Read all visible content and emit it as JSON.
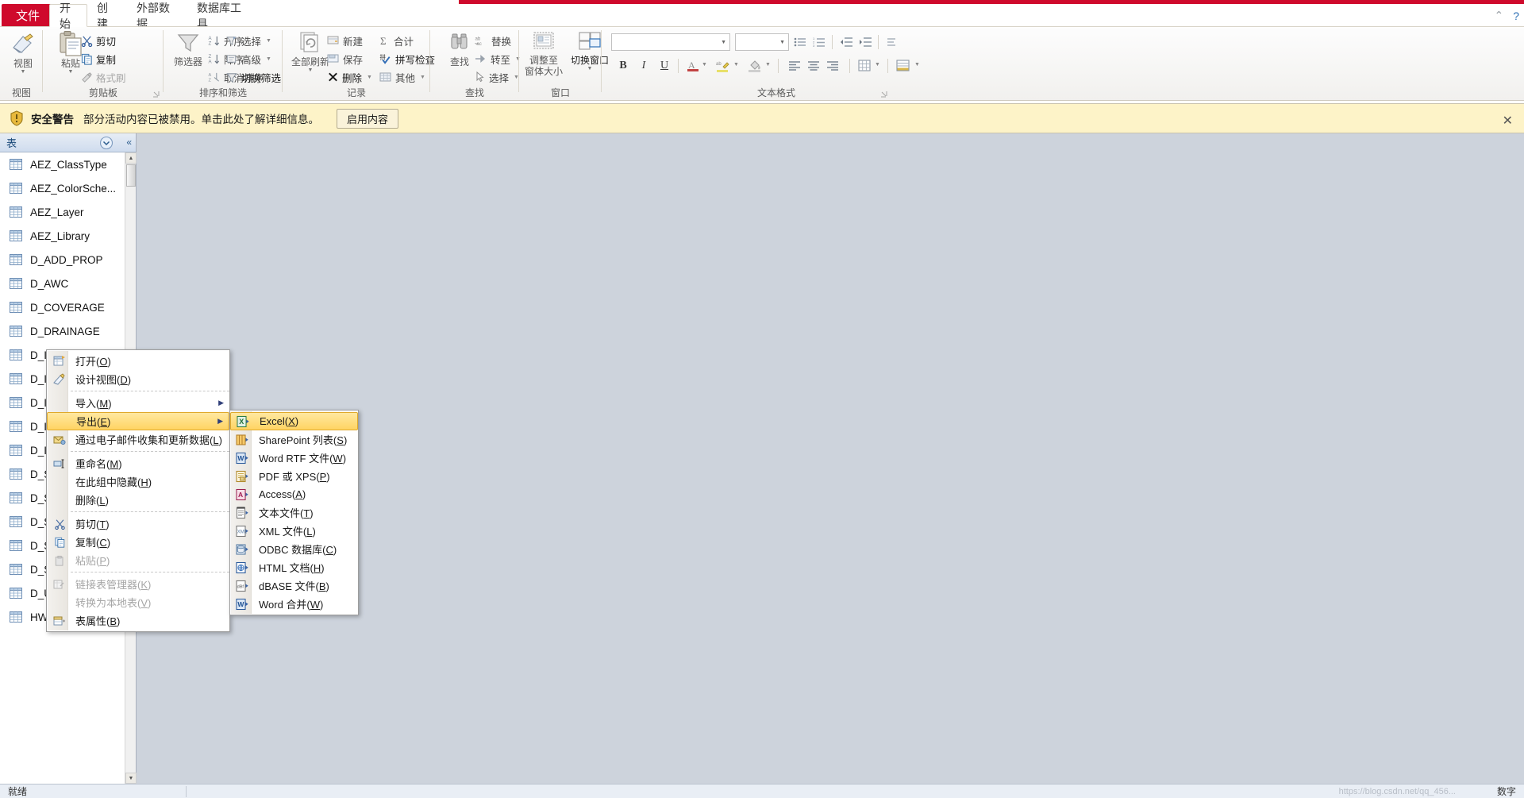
{
  "window": {
    "minimize_icon": "minimize-icon",
    "help_icon": "help-icon"
  },
  "tabs": {
    "file": "文件",
    "items": [
      {
        "label": "开始",
        "active": true
      },
      {
        "label": "创建",
        "active": false
      },
      {
        "label": "外部数据",
        "active": false
      },
      {
        "label": "数据库工具",
        "active": false
      }
    ]
  },
  "ribbon": {
    "groups": [
      {
        "name": "视图"
      },
      {
        "name": "剪贴板"
      },
      {
        "name": "排序和筛选"
      },
      {
        "name": "记录"
      },
      {
        "name": "查找"
      },
      {
        "name": "窗口"
      },
      {
        "name": "文本格式"
      }
    ],
    "view": {
      "label": "视图"
    },
    "clipboard": {
      "paste": "粘贴",
      "cut": "剪切",
      "copy": "复制",
      "format_painter": "格式刷"
    },
    "sort_filter": {
      "filter": "筛选器",
      "asc": "升序",
      "desc": "降序",
      "clear_sort": "取消排序",
      "selection": "选择",
      "advanced": "高级",
      "toggle_filter": "切换筛选"
    },
    "records": {
      "refresh_all": "全部刷新",
      "new": "新建",
      "save": "保存",
      "delete": "删除",
      "totals": "合计",
      "spelling": "拼写检查",
      "more": "其他"
    },
    "find": {
      "find": "查找",
      "replace": "替换",
      "goto": "转至",
      "select": "选择"
    },
    "window": {
      "size_to_form": "调整至\n窗体大小",
      "size_to_form_line1": "调整至",
      "size_to_form_line2": "窗体大小",
      "switch_windows": "切换窗口"
    },
    "text_format": {
      "font_name": "",
      "font_size": "",
      "bold": "B",
      "italic": "I",
      "underline": "U"
    }
  },
  "security_bar": {
    "title": "安全警告",
    "message": "部分活动内容已被禁用。单击此处了解详细信息。",
    "button": "启用内容",
    "close": "✕"
  },
  "nav_pane": {
    "header": "表",
    "collapse": "«",
    "tables": [
      "AEZ_ClassType",
      "AEZ_ColorSche...",
      "AEZ_Layer",
      "AEZ_Library",
      "D_ADD_PROP",
      "D_AWC",
      "D_COVERAGE",
      "D_DRAINAGE",
      "D_I",
      "D_I",
      "D_I",
      "D_I",
      "D_I",
      "D_S",
      "D_S",
      "D_S",
      "D_S",
      "D_S",
      "D_U",
      "HWSD_Metadata"
    ]
  },
  "context_menu": {
    "items": [
      {
        "label": "打开(O)",
        "icon": "open-table-icon",
        "type": "item"
      },
      {
        "label": "设计视图(D)",
        "icon": "design-view-icon",
        "type": "item"
      },
      {
        "type": "separator"
      },
      {
        "label": "导入(M)",
        "icon": "",
        "type": "submenu"
      },
      {
        "label": "导出(E)",
        "icon": "",
        "type": "submenu",
        "highlighted": true
      },
      {
        "label": "通过电子邮件收集和更新数据(L)",
        "icon": "email-collect-icon",
        "type": "item"
      },
      {
        "type": "separator"
      },
      {
        "label": "重命名(M)",
        "icon": "rename-icon",
        "type": "item"
      },
      {
        "label": "在此组中隐藏(H)",
        "icon": "",
        "type": "item"
      },
      {
        "label": "删除(L)",
        "icon": "",
        "type": "item"
      },
      {
        "type": "separator"
      },
      {
        "label": "剪切(T)",
        "icon": "cut-icon",
        "type": "item"
      },
      {
        "label": "复制(C)",
        "icon": "copy-icon",
        "type": "item"
      },
      {
        "label": "粘贴(P)",
        "icon": "paste-icon",
        "type": "item",
        "disabled": true
      },
      {
        "type": "separator"
      },
      {
        "label": "链接表管理器(K)",
        "icon": "linked-table-icon",
        "type": "item",
        "disabled": true
      },
      {
        "label": "转换为本地表(V)",
        "icon": "",
        "type": "item",
        "disabled": true
      },
      {
        "label": "表属性(B)",
        "icon": "table-properties-icon",
        "type": "item"
      }
    ]
  },
  "export_submenu": {
    "items": [
      {
        "label": "Excel(X)",
        "icon": "excel-icon",
        "highlighted": true
      },
      {
        "label": "SharePoint 列表(S)",
        "icon": "sharepoint-icon"
      },
      {
        "label": "Word RTF 文件(W)",
        "icon": "word-icon"
      },
      {
        "label": "PDF 或 XPS(P)",
        "icon": "pdf-icon"
      },
      {
        "label": "Access(A)",
        "icon": "access-icon"
      },
      {
        "label": "文本文件(T)",
        "icon": "textfile-icon"
      },
      {
        "label": "XML 文件(L)",
        "icon": "xml-icon"
      },
      {
        "label": "ODBC 数据库(C)",
        "icon": "odbc-icon"
      },
      {
        "label": "HTML 文档(H)",
        "icon": "html-icon"
      },
      {
        "label": "dBASE 文件(B)",
        "icon": "dbase-icon"
      },
      {
        "label": "Word 合并(W)",
        "icon": "wordmerge-icon"
      }
    ]
  },
  "status_bar": {
    "text": "就绪",
    "right_text": "数字",
    "watermark": "https://blog.csdn.net/qq_456..."
  },
  "colors": {
    "accent": "#cf0a2c",
    "warning_bg": "#fdf3c8",
    "highlight": "#ffd463",
    "workspace": "#cdd3dc"
  }
}
